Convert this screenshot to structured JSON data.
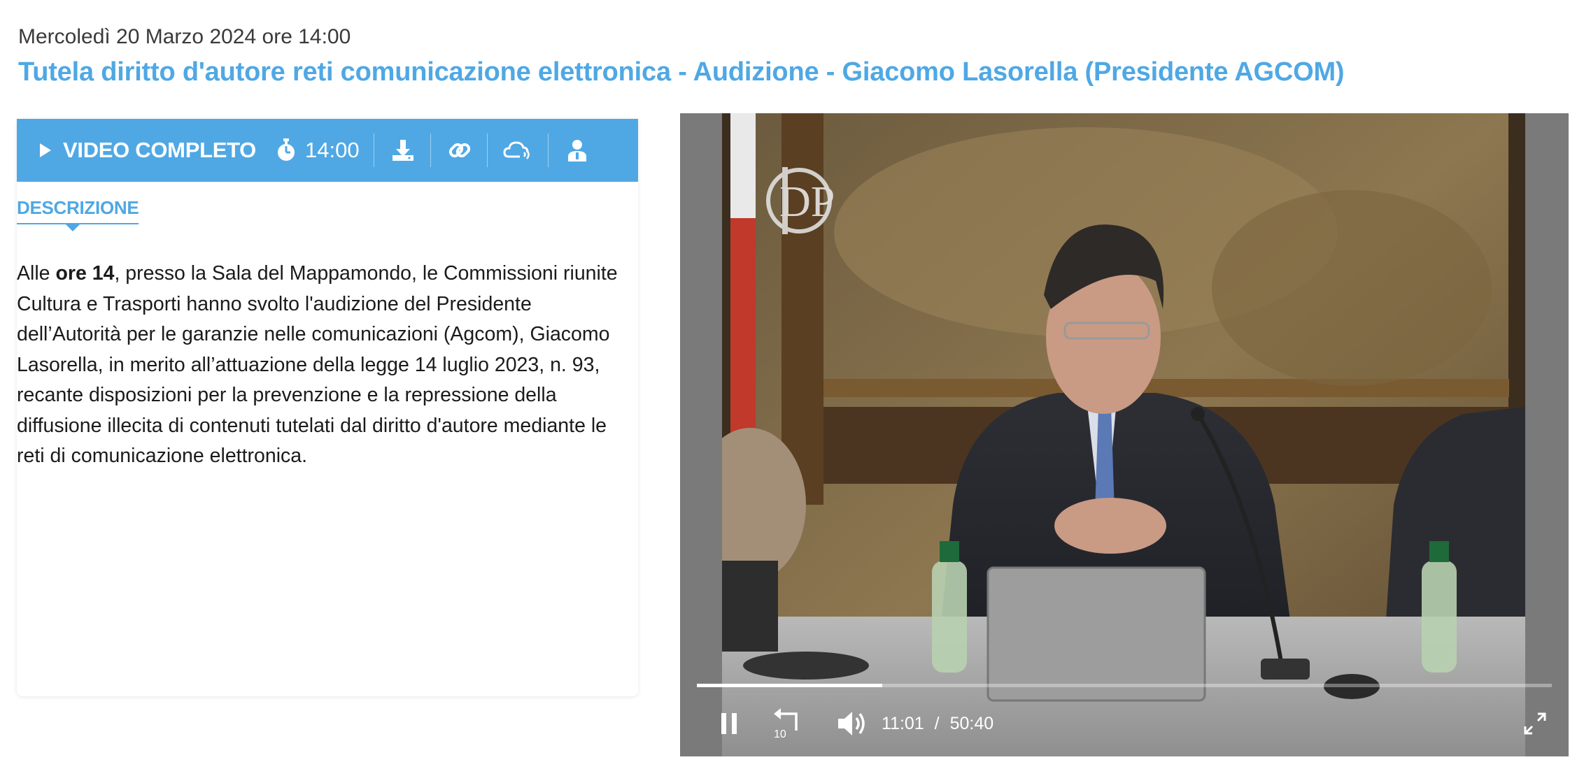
{
  "header": {
    "datetime": "Mercoledì 20 Marzo 2024 ore 14:00",
    "title": "Tutela diritto d'autore reti comunicazione elettronica - Audizione - Giacomo Lasorella (Presidente AGCOM)"
  },
  "toolbar": {
    "play_icon": "play-icon",
    "label": "VIDEO COMPLETO",
    "timer_icon": "stopwatch-icon",
    "time": "14:00",
    "icons": [
      "download-icon",
      "link-icon",
      "podcast-cloud-icon",
      "speaker-person-icon"
    ]
  },
  "tabs": {
    "description": "DESCRIZIONE"
  },
  "description": {
    "pre": "Alle ",
    "bold": "ore 14",
    "post": ", presso la Sala del Mappamondo, le Commissioni riunite Cultura e Trasporti hanno svolto l'audizione del Presidente dell’Autorità per le garanzie nelle comunicazioni (Agcom), Giacomo Lasorella, in merito all’attuazione della legge 14 luglio 2023, n. 93, recante disposizioni per la prevenzione e la repressione della diffusione illecita di contenuti tutelati dal diritto d'autore mediante le reti di comunicazione elettronica."
  },
  "player": {
    "current_time": "11:01",
    "separator": "/",
    "duration": "50:40",
    "progress_fraction": 0.217,
    "rewind_seconds": "10",
    "logo_letters": "DP"
  },
  "colors": {
    "accent": "#4fa8e4",
    "player_bg": "#7a7a7a"
  }
}
